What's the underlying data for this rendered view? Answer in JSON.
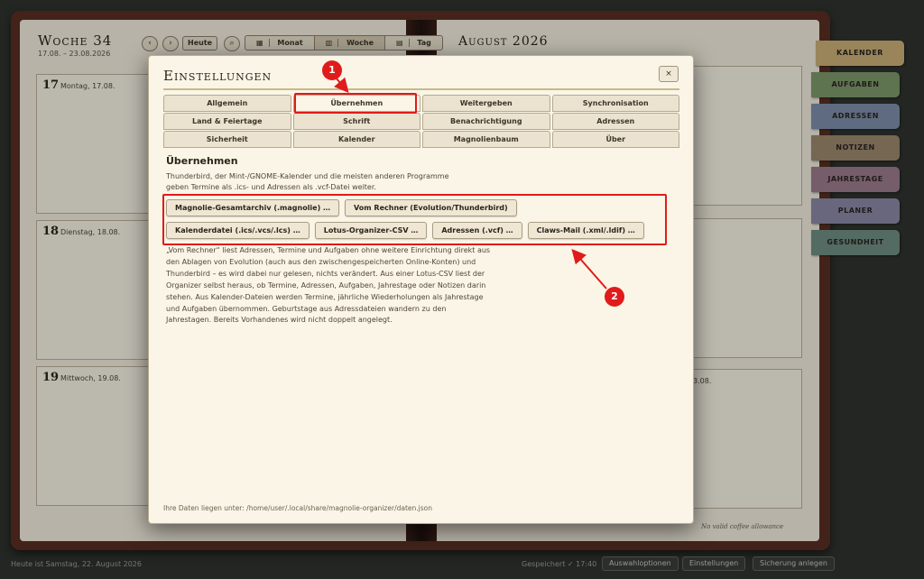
{
  "planner": {
    "week_title": "Woche 34",
    "week_range": "17.08. – 23.08.2026",
    "prev_icon": "‹",
    "next_icon": "›",
    "today_label": "Heute",
    "search_icon": "⌕",
    "views": [
      {
        "icon": "▦",
        "label": "Monat"
      },
      {
        "icon": "▥",
        "label": "Woche"
      },
      {
        "icon": "▤",
        "label": "Tag"
      }
    ],
    "days": [
      {
        "num": "17",
        "name": "Montag, 17.08."
      },
      {
        "num": "18",
        "name": "Dienstag, 18.08."
      },
      {
        "num": "19",
        "name": "Mittwoch, 19.08."
      }
    ],
    "month_title": "August 2026",
    "right_partial_label": "3.08.",
    "coffee_note": "No valid coffee allowance"
  },
  "side_tabs": [
    {
      "label": "KALENDER",
      "color": "#cdb277"
    },
    {
      "label": "AUFGABEN",
      "color": "#7e9a6b"
    },
    {
      "label": "ADRESSEN",
      "color": "#7f8fab"
    },
    {
      "label": "NOTIZEN",
      "color": "#9c8a6e"
    },
    {
      "label": "JAHRESTAGE",
      "color": "#9c7d8e"
    },
    {
      "label": "PLANER",
      "color": "#8d8aa8"
    },
    {
      "label": "GESUNDHEIT",
      "color": "#6f8f85"
    }
  ],
  "status": {
    "today_text": "Heute ist Samstag, 22. August 2026",
    "saved_text": "Gespeichert ✓ 17:40",
    "btn_options": "Auswahloptionen",
    "btn_settings": "Einstellungen",
    "btn_backup": "Sicherung anlegen"
  },
  "modal": {
    "title": "Einstellungen",
    "close_label": "×",
    "tabs": [
      "Allgemein",
      "Übernehmen",
      "Weitergeben",
      "Synchronisation",
      "Land & Feiertage",
      "Schrift",
      "Benachrichtigung",
      "Adressen",
      "Sicherheit",
      "Kalender",
      "Magnolienbaum",
      "Über"
    ],
    "active_tab": "Übernehmen",
    "section_title": "Übernehmen",
    "intro": "Thunderbird, der Mint-/GNOME-Kalender und die meisten anderen Programme geben Termine als .ics- und Adressen als .vcf-Datei weiter.",
    "buttons_row1": [
      "Magnolie-Gesamtarchiv (.magnolie) …",
      "Vom Rechner (Evolution/Thunderbird)"
    ],
    "buttons_row2": [
      "Kalenderdatei (.ics/.vcs/.lcs) …",
      "Lotus-Organizer-CSV …",
      "Adressen (.vcf) …",
      "Claws-Mail (.xml/.ldif) …"
    ],
    "description": "„Vom Rechner“ liest Adressen, Termine und Aufgaben ohne weitere Einrichtung direkt aus den Ablagen von Evolution (auch aus den zwischengespeicherten Online-Konten) und Thunderbird – es wird dabei nur gelesen, nichts verändert. Aus einer Lotus-CSV liest der Organizer selbst heraus, ob Termine, Adressen, Aufgaben, Jahrestage oder Notizen darin stehen. Aus Kalender-Dateien werden Termine, jährliche Wiederholungen als Jahrestage und Aufgaben übernommen. Geburtstage aus Adressdateien wandern zu den Jahrestagen. Bereits Vorhandenes wird nicht doppelt angelegt.",
    "footer_path": "Ihre Daten liegen unter: /home/user/.local/share/magnolie-organizer/daten.json"
  },
  "annotations": {
    "badge1": "1",
    "badge2": "2",
    "color": "#e01b1b"
  }
}
